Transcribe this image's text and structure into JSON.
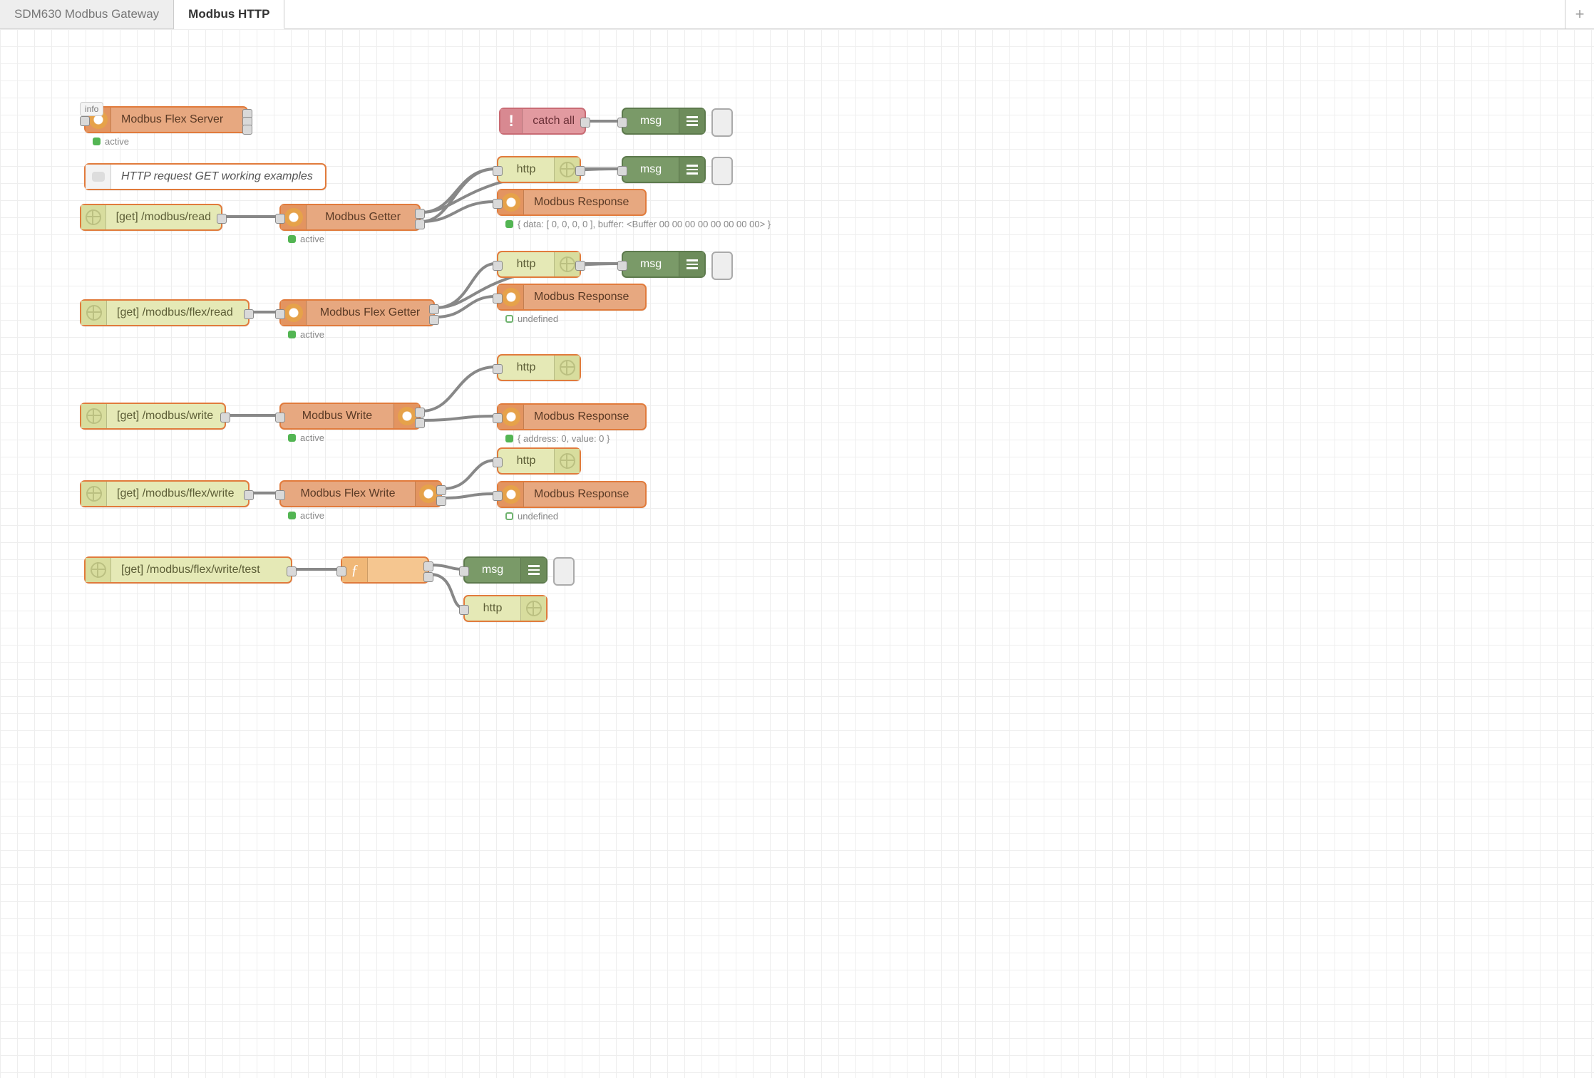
{
  "tabs": {
    "t0": "SDM630 Modbus Gateway",
    "t1": "Modbus HTTP",
    "active": 1,
    "add": "+"
  },
  "badge_info": "info",
  "flex_server": {
    "label": "Modbus Flex Server",
    "status": "active"
  },
  "catch": {
    "label": "catch all"
  },
  "dbg_catch": {
    "label": "msg"
  },
  "comment": {
    "label": "HTTP request GET working examples"
  },
  "http_in_read": {
    "label": "[get] /modbus/read"
  },
  "getter": {
    "label": "Modbus Getter",
    "status": "active"
  },
  "http_out_1": {
    "label": "http"
  },
  "dbg_1": {
    "label": "msg"
  },
  "resp_1": {
    "label": "Modbus Response",
    "status": "{ data: [ 0, 0, 0, 0 ], buffer: <Buffer 00 00 00 00 00 00 00 00> }"
  },
  "http_in_flex_read": {
    "label": "[get] /modbus/flex/read"
  },
  "flex_getter": {
    "label": "Modbus Flex Getter",
    "status": "active"
  },
  "http_out_2": {
    "label": "http"
  },
  "dbg_2": {
    "label": "msg"
  },
  "resp_2": {
    "label": "Modbus Response",
    "status": "undefined"
  },
  "http_in_write": {
    "label": "[get] /modbus/write"
  },
  "writer": {
    "label": "Modbus Write",
    "status": "active"
  },
  "http_out_3": {
    "label": "http"
  },
  "resp_3": {
    "label": "Modbus Response",
    "status": "{ address: 0, value: 0 }"
  },
  "http_in_flex_write": {
    "label": "[get] /modbus/flex/write"
  },
  "flex_writer": {
    "label": "Modbus Flex Write",
    "status": "active"
  },
  "http_out_4": {
    "label": "http"
  },
  "resp_4": {
    "label": "Modbus Response",
    "status": "undefined"
  },
  "http_in_test": {
    "label": "[get] /modbus/flex/write/test"
  },
  "func": {
    "label": ""
  },
  "dbg_test": {
    "label": "msg"
  },
  "http_out_5": {
    "label": "http"
  }
}
